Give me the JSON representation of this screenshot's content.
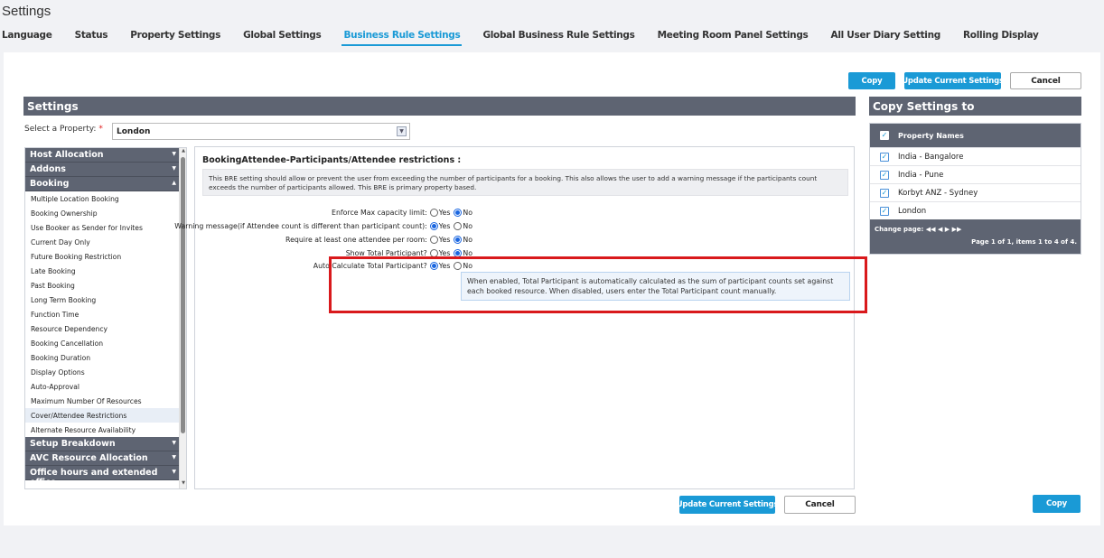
{
  "app": {
    "title": "Settings"
  },
  "tabs": [
    {
      "label": "Language"
    },
    {
      "label": "Status"
    },
    {
      "label": "Property Settings"
    },
    {
      "label": "Global Settings"
    },
    {
      "label": "Business Rule Settings",
      "active": true
    },
    {
      "label": "Global Business Rule Settings"
    },
    {
      "label": "Meeting Room Panel Settings"
    },
    {
      "label": "All User Diary Setting"
    },
    {
      "label": "Rolling Display"
    }
  ],
  "toolbar": {
    "copy": "Copy",
    "update": "Update Current Settings",
    "cancel": "Cancel"
  },
  "settings_panel": {
    "title": "Settings",
    "property_label": "Select a Property:",
    "required_mark": "*",
    "property_value": "London"
  },
  "nav": {
    "groups_top": [
      {
        "label": "Host Allocation",
        "caret": "▼"
      },
      {
        "label": "Addons",
        "caret": "▼"
      },
      {
        "label": "Booking",
        "caret": "▲"
      }
    ],
    "items": [
      "Multiple Location Booking",
      "Booking Ownership",
      "Use Booker as Sender for Invites",
      "Current Day Only",
      "Future Booking Restriction",
      "Late Booking",
      "Past Booking",
      "Long Term Booking",
      "Function Time",
      "Resource Dependency",
      "Booking Cancellation",
      "Booking Duration",
      "Display Options",
      "Auto-Approval",
      "Maximum Number Of Resources",
      "Cover/Attendee Restrictions",
      "Alternate Resource Availability"
    ],
    "active_item": "Cover/Attendee Restrictions",
    "groups_bottom": [
      {
        "label": "Setup Breakdown",
        "caret": "▼"
      },
      {
        "label": "AVC Resource Allocation",
        "caret": "▼"
      },
      {
        "label": "Office hours and extended office",
        "caret": "▼"
      }
    ]
  },
  "content": {
    "title": "BookingAttendee-Participants/Attendee restrictions :",
    "description": "This BRE setting should allow or prevent the user from exceeding the number of participants for a booking. This also allows the user to add a warning message if the participants count exceeds the number of participants allowed. This BRE is primary property based.",
    "yes": "Yes",
    "no": "No",
    "rows": [
      {
        "label": "Enforce Max capacity limit:",
        "value": "No"
      },
      {
        "label": "Warning message(if Attendee count is different than participant count):",
        "value": "Yes"
      },
      {
        "label": "Require at least one attendee per room:",
        "value": "No"
      },
      {
        "label": "Show Total Participant?",
        "value": "No"
      },
      {
        "label": "Auto Calculate Total Participant?",
        "value": "Yes"
      }
    ],
    "info": "When enabled, Total Participant is automatically calculated as the sum of participant counts set against each booked resource. When disabled, users enter the Total Participant count manually."
  },
  "copy_panel": {
    "title": "Copy Settings to",
    "column": "Property Names",
    "check_mark": "✓",
    "rows": [
      "India - Bangalore",
      "India - Pune",
      "Korbyt ANZ - Sydney",
      "London"
    ],
    "pager_label": "Change page:",
    "pager_controls": "◀◀  ◀  ▶  ▶▶",
    "pager_info": "Page 1 of 1, items 1 to 4 of 4."
  },
  "bottom": {
    "update": "Update Current Settings",
    "cancel": "Cancel",
    "copy": "Copy"
  },
  "colors": {
    "accent": "#1a9ad6",
    "panel_header": "#5e6472",
    "highlight": "#d9191c"
  }
}
